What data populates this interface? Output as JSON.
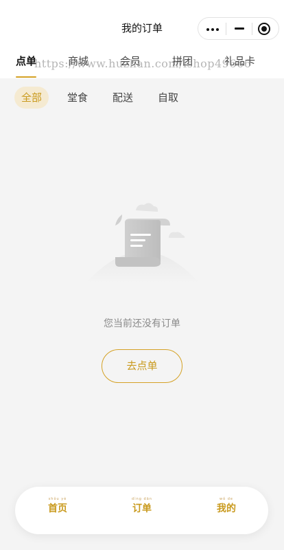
{
  "header": {
    "title": "我的订单"
  },
  "capsule": {
    "more_icon": "more-dots-icon",
    "minimize_icon": "minus-icon",
    "close_icon": "target-circle-icon"
  },
  "top_tabs": [
    {
      "label": "点单",
      "active": true
    },
    {
      "label": "商城",
      "active": false
    },
    {
      "label": "会员",
      "active": false
    },
    {
      "label": "拼团",
      "active": false
    },
    {
      "label": "礼品卡",
      "active": false
    }
  ],
  "watermark": "https://www.huzhan.com/ishop49666",
  "filters": [
    {
      "label": "全部",
      "active": true
    },
    {
      "label": "堂食",
      "active": false
    },
    {
      "label": "配送",
      "active": false
    },
    {
      "label": "自取",
      "active": false
    }
  ],
  "empty_state": {
    "illustration_icon": "empty-order-scroll-icon",
    "message": "您当前还没有订单",
    "button_label": "去点单"
  },
  "bottom_nav": [
    {
      "pinyin": "shǒu yè",
      "label": "首页"
    },
    {
      "pinyin": "dìng dān",
      "label": "订单"
    },
    {
      "pinyin": "wǒ de",
      "label": "我的"
    }
  ],
  "colors": {
    "accent": "#d4a124",
    "accent_text": "#c99a1e",
    "chip_bg": "#f5ead1",
    "page_bg": "#f4f4f4"
  }
}
